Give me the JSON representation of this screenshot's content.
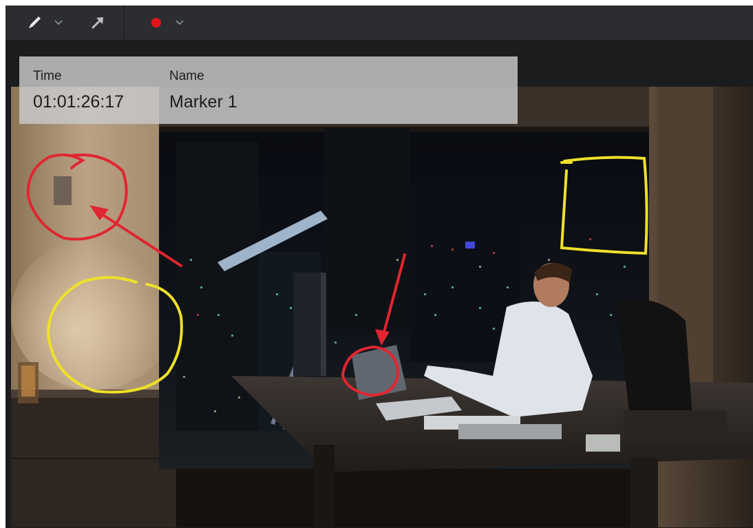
{
  "toolbar": {
    "pen_tool_icon": "pen-icon",
    "pen_dropdown_icon": "chevron-down-icon",
    "arrow_tool_icon": "arrow-icon",
    "color_tool_icon": "red-dot-icon",
    "color_dropdown_icon": "chevron-down-icon",
    "selected_color": "#e3131b"
  },
  "marker": {
    "time_label": "Time",
    "time_value": "01:01:26:17",
    "name_label": "Name",
    "name_value": "Marker 1"
  },
  "annotations": {
    "red_color": "#e02630",
    "yellow_color": "#f0e02a",
    "shapes": [
      "red-circle",
      "red-arrow",
      "yellow-circle",
      "yellow-rectangle",
      "red-circle",
      "red-arrow"
    ]
  }
}
